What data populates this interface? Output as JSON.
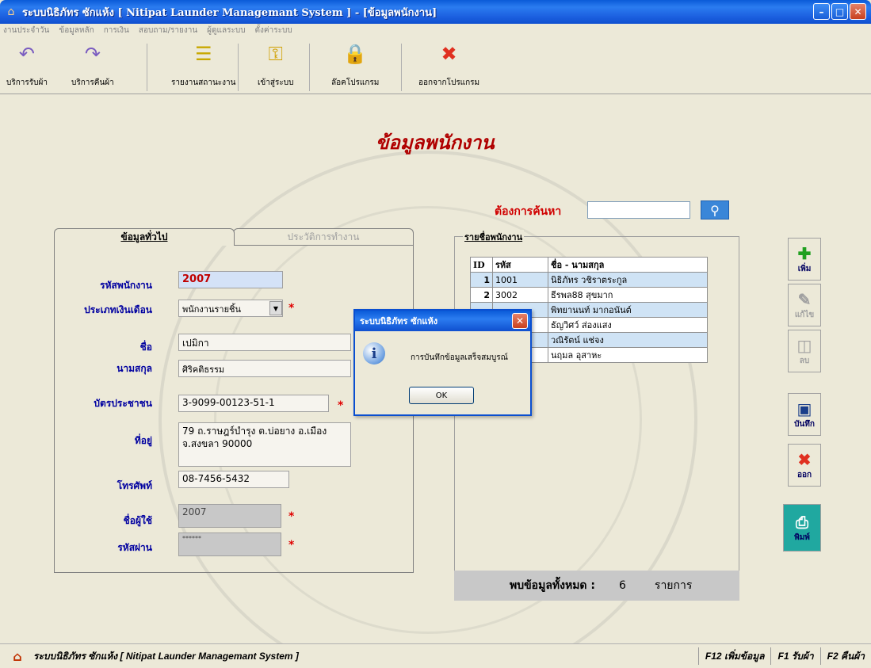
{
  "window": {
    "title": "ระบบนิธิภัทร ซักแห้ง [ Nitipat Launder Managemant System ] - [ข้อมูลพนักงาน]"
  },
  "menu": [
    "งานประจำวัน",
    "ข้อมูลหลัก",
    "การเงิน",
    "สอบถาม/รายงาน",
    "ผู้ดูแลระบบ",
    "ตั้งค่าระบบ"
  ],
  "toolbar": {
    "items": [
      {
        "label": "บริการรับผ้า",
        "icon": "receive-icon"
      },
      {
        "label": "บริการคืนผ้า",
        "icon": "return-icon"
      },
      {
        "label": "รายงานสถานะงาน",
        "icon": "report-icon"
      },
      {
        "label": "เข้าสู่ระบบ",
        "icon": "key-icon"
      },
      {
        "label": "ล๊อคโปรแกรม",
        "icon": "lock-icon"
      },
      {
        "label": "ออกจากโปรแกรม",
        "icon": "exit-icon"
      }
    ]
  },
  "page": {
    "title": "ข้อมูลพนักงาน",
    "search_label": "ต้องการค้นหา"
  },
  "tabs": {
    "general": "ข้อมูลทั่วไป",
    "history": "ประวัติการทำงาน"
  },
  "form": {
    "employee_id_label": "รหัสพนักงาน",
    "employee_id": "2007",
    "salary_type_label": "ประเภทเงินเดือน",
    "salary_type": "พนักงานรายชิ้น",
    "first_name_label": "ชื่อ",
    "first_name": "เปมิกา",
    "last_name_label": "นามสกุล",
    "last_name": "ศิริคติธรรม",
    "id_card_label": "บัตรประชาชน",
    "id_card": "3-9099-00123-51-1",
    "address_label": "ที่อยู่",
    "address": "79 ถ.ราษฎร์บำรุง ต.บ่อยาง อ.เมือง จ.สงขลา 90000",
    "phone_label": "โทรศัพท์",
    "phone": "08-7456-5432",
    "username_label": "ชื่อผู้ใช้",
    "username": "2007",
    "password_label": "รหัสผ่าน",
    "password": "******"
  },
  "list": {
    "title": "รายชื่อพนักงาน",
    "headers": [
      "ID",
      "รหัส",
      "ชื่อ - นามสกุล"
    ],
    "rows": [
      {
        "id": "1",
        "code": "1001",
        "name": "นิธิภัทร วชิราตระกูล"
      },
      {
        "id": "2",
        "code": "3002",
        "name": "ธีรพล88 สุขมาก"
      },
      {
        "id": "",
        "code": "",
        "name": "พิทยานนท์ มากอนันต์"
      },
      {
        "id": "",
        "code": "",
        "name": "ธัญวิศว์ ส่องแสง"
      },
      {
        "id": "",
        "code": "",
        "name": "วณิรัตน์ แช่จง"
      },
      {
        "id": "",
        "code": "",
        "name": "นฤมล อุสาหะ"
      }
    ],
    "total_label": "พบข้อมูลทั้งหมด :",
    "total_count": "6",
    "total_unit": "รายการ"
  },
  "side_buttons": {
    "add": "เพิ่ม",
    "edit": "แก้ไข",
    "delete": "ลบ",
    "save": "บันทึก",
    "exit": "ออก",
    "print": "พิมพ์"
  },
  "dialog": {
    "title": "ระบบนิธิภัทร ซักแห้ง",
    "message": "การบันทึกข้อมูลเสร็จสมบูรณ์",
    "ok": "OK"
  },
  "statusbar": {
    "text": "ระบบนิธิภัทร ซักแห้ง [ Nitipat Launder Managemant System ]",
    "f12": "F12 เพิ่มข้อมูล",
    "f1": "F1 รับผ้า",
    "f2": "F2 คืนผ้า"
  }
}
